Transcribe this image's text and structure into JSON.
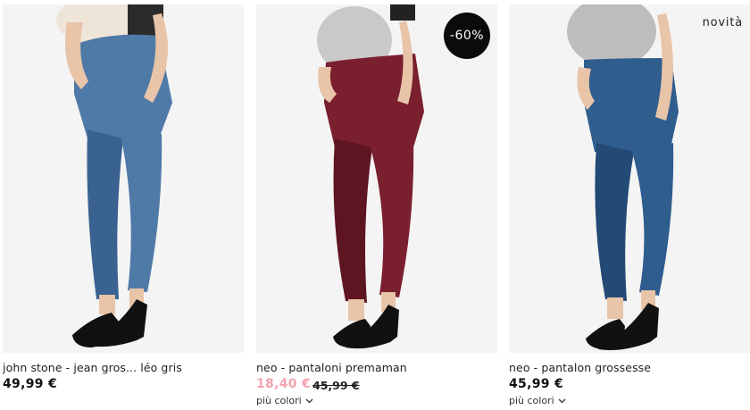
{
  "products": [
    {
      "name": "john stone - jean gros... léo gris",
      "price": "49,99 €",
      "image_icon": "product-photo-icon",
      "colors": {
        "jeans": "#4f7aa8",
        "jeans_dark": "#3a6291",
        "band": "#2a2a2a",
        "top": "#efe4d8",
        "skin": "#e8c4a8",
        "shoe": "#111111"
      }
    },
    {
      "name": "neo - pantaloni premaman",
      "sale_price": "18,40 €",
      "old_price": "45,99 €",
      "badge": "-60%",
      "more_colors": "più colori",
      "image_icon": "product-photo-icon",
      "colors": {
        "jeans": "#7a1f2e",
        "jeans_dark": "#5e1522",
        "band": "#b9b9b9",
        "top": "#c9c9c9",
        "skin": "#e8c4a8",
        "shoe": "#111111"
      }
    },
    {
      "name": "neo - pantalon grossesse",
      "price": "45,99 €",
      "tag": "novità",
      "more_colors": "più colori",
      "image_icon": "product-photo-icon",
      "colors": {
        "jeans": "#2f5d8e",
        "jeans_dark": "#234a75",
        "band": "#a8a8a8",
        "top": "#bdbdbd",
        "skin": "#e8c4a8",
        "shoe": "#111111"
      }
    }
  ]
}
